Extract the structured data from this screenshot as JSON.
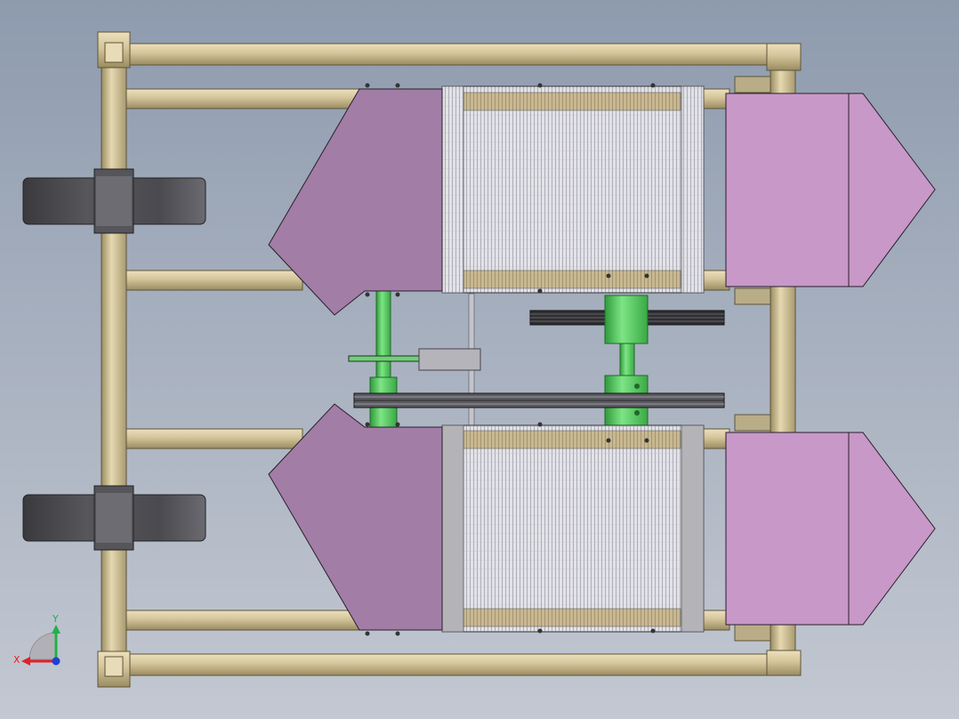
{
  "viewport": {
    "background_top": "#8e9bae",
    "background_bottom": "#c3c8d2"
  },
  "colors": {
    "frame": "#d4c49a",
    "frame_dark": "#8a7d58",
    "frame_light": "#ece0bc",
    "wheel": "#4b4b4f",
    "wheel_dark": "#2e2e31",
    "hub": "#5a5a5e",
    "hood_left": "#a27da6",
    "hood_right": "#c898c8",
    "shaft_green": "#5fd36a",
    "shaft_green_dark": "#2f9a3a",
    "pulley_dark": "#333338",
    "grate": "#dcdce2",
    "grate_lines": "#9a9aa6",
    "grate_end": "#b8b8bc",
    "bracket": "#c8c8cc"
  },
  "triad": {
    "x_label": "X",
    "y_label": "Y",
    "x_color": "#e0202a",
    "y_color": "#22b04a",
    "z_color": "#2040d0"
  }
}
